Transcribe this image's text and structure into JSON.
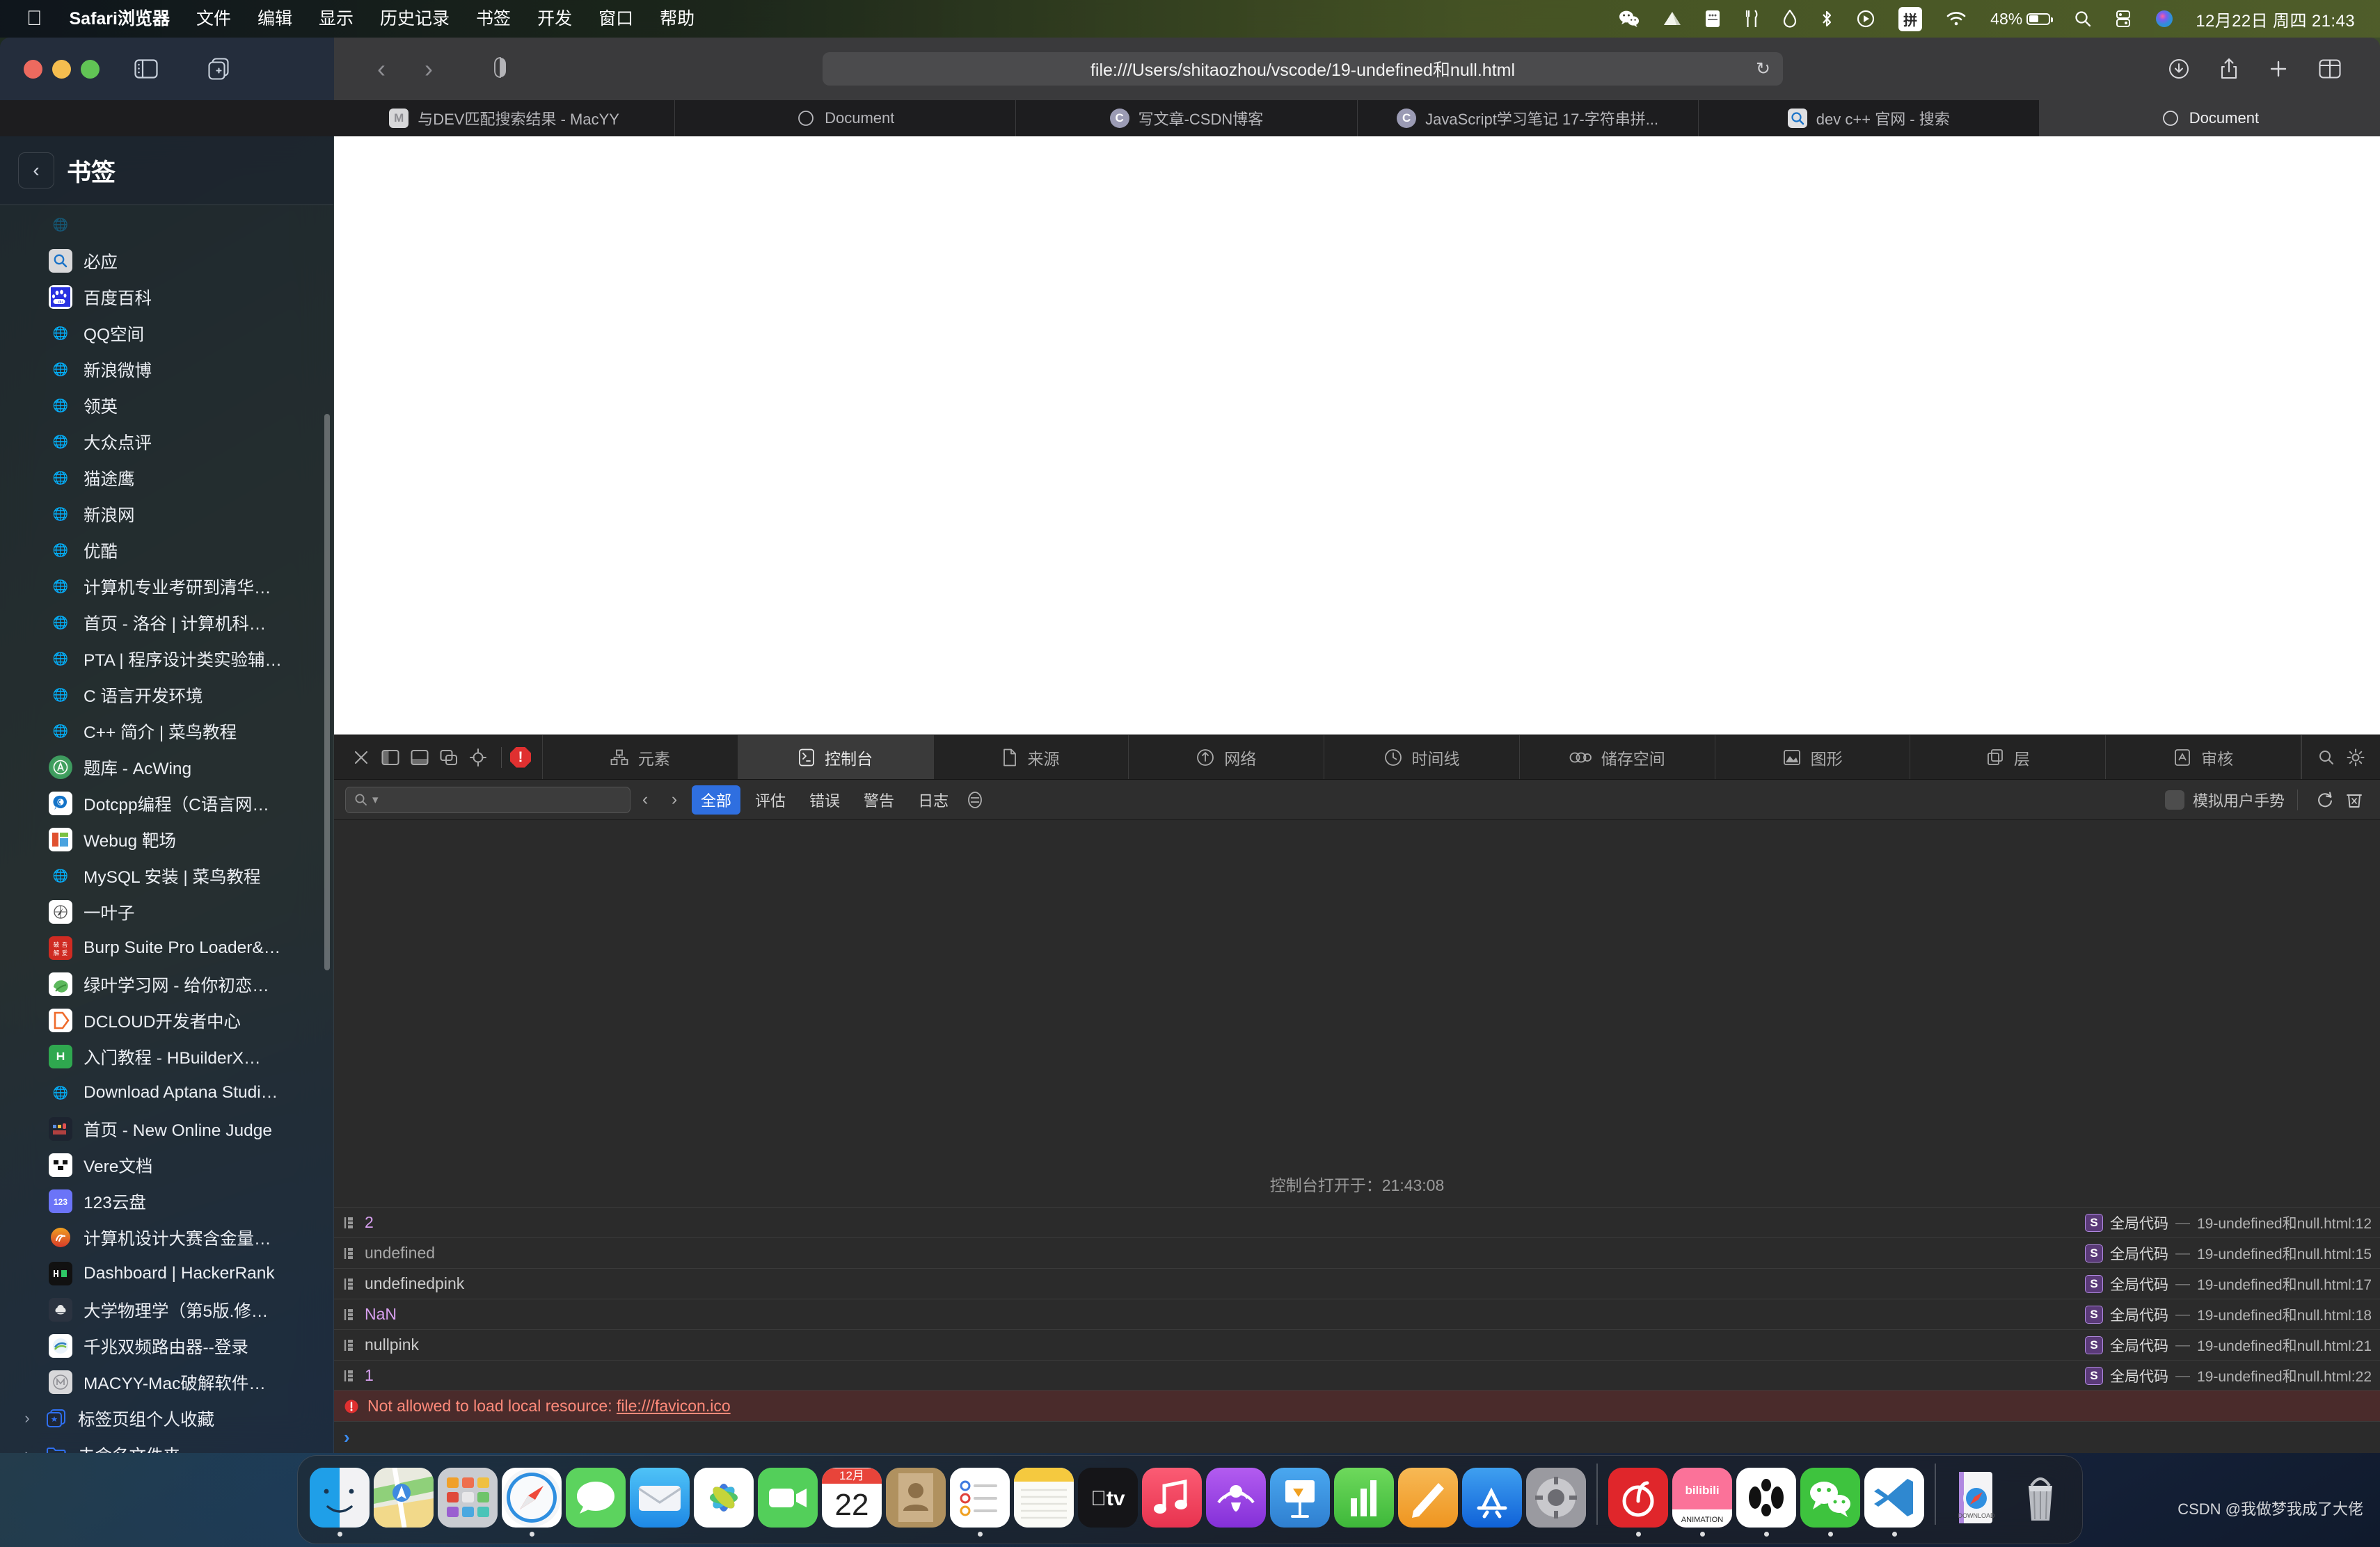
{
  "menubar": {
    "apple_icon": "apple-logo",
    "items": [
      "Safari浏览器",
      "文件",
      "编辑",
      "显示",
      "历史记录",
      "书签",
      "开发",
      "窗口",
      "帮助"
    ],
    "status_icons": [
      "wechat-icon",
      "cloud-icon",
      "memory-icon",
      "utensils-icon",
      "droplet-icon",
      "bluetooth-icon",
      "play-circle-icon",
      "input-source-icon",
      "wifi-icon"
    ],
    "battery_percent": "48%",
    "search_icon": "spotlight-search-icon",
    "control_center_icon": "control-center-icon",
    "siri_icon": "siri-icon",
    "clock": "12月22日 周四  21:43"
  },
  "toolbar": {
    "sidebar_icon": "sidebar-toggle-icon",
    "newtab_icon": "new-tab-overview-icon",
    "back_icon": "chevron-left-icon",
    "forward_icon": "chevron-right-icon",
    "shield_icon": "privacy-shield-icon",
    "url": "file:///Users/shitaozhou/vscode/19-undefined和null.html",
    "reload_icon": "reload-icon",
    "download_icon": "download-icon",
    "share_icon": "share-icon",
    "plus_icon": "new-tab-icon",
    "tabs_icon": "show-all-tabs-icon"
  },
  "tabs": [
    {
      "label": "与DEV匹配搜索结果 - MacYY",
      "favicon": "macyy-favicon",
      "favicon_letter": "M",
      "active": false
    },
    {
      "label": "Document",
      "favicon": "safari-compass-favicon",
      "favicon_letter": "",
      "active": false
    },
    {
      "label": "写文章-CSDN博客",
      "favicon": "csdn-favicon",
      "favicon_letter": "C",
      "active": false
    },
    {
      "label": "JavaScript学习笔记 17-字符串拼...",
      "favicon": "csdn-favicon",
      "favicon_letter": "C",
      "active": false
    },
    {
      "label": "dev c++ 官网 - 搜索",
      "favicon": "bing-favicon",
      "favicon_letter": "Q",
      "active": false
    },
    {
      "label": "Document",
      "favicon": "safari-compass-favicon",
      "favicon_letter": "",
      "active": true
    }
  ],
  "sidebar": {
    "back_icon": "chevron-left-icon",
    "title": "书签",
    "bookmarks": [
      {
        "label": "",
        "icon": "globe-icon",
        "icon_kind": "globe",
        "clipped": true
      },
      {
        "label": "必应",
        "icon": "bing-icon",
        "icon_kind": "bing"
      },
      {
        "label": "百度百科",
        "icon": "baidu-icon",
        "icon_kind": "baidu"
      },
      {
        "label": "QQ空间",
        "icon": "globe-icon",
        "icon_kind": "globe"
      },
      {
        "label": "新浪微博",
        "icon": "globe-icon",
        "icon_kind": "globe"
      },
      {
        "label": "领英",
        "icon": "globe-icon",
        "icon_kind": "globe"
      },
      {
        "label": "大众点评",
        "icon": "globe-icon",
        "icon_kind": "globe"
      },
      {
        "label": "猫途鹰",
        "icon": "globe-icon",
        "icon_kind": "globe"
      },
      {
        "label": "新浪网",
        "icon": "globe-icon",
        "icon_kind": "globe"
      },
      {
        "label": "优酷",
        "icon": "globe-icon",
        "icon_kind": "globe"
      },
      {
        "label": "计算机专业考研到清华…",
        "icon": "globe-icon",
        "icon_kind": "globe"
      },
      {
        "label": "首页 - 洛谷 | 计算机科…",
        "icon": "globe-icon",
        "icon_kind": "globe"
      },
      {
        "label": "PTA | 程序设计类实验辅…",
        "icon": "globe-icon",
        "icon_kind": "globe"
      },
      {
        "label": "C 语言开发环境",
        "icon": "globe-icon",
        "icon_kind": "globe"
      },
      {
        "label": "C++ 简介 | 菜鸟教程",
        "icon": "globe-icon",
        "icon_kind": "globe"
      },
      {
        "label": "题库 - AcWing",
        "icon": "acwing-icon",
        "icon_kind": "acwing"
      },
      {
        "label": "Dotcpp编程（C语言网…",
        "icon": "dotcpp-icon",
        "icon_kind": "dotcpp"
      },
      {
        "label": "Webug 靶场",
        "icon": "webug-icon",
        "icon_kind": "webug"
      },
      {
        "label": "MySQL 安装 | 菜鸟教程",
        "icon": "globe-icon",
        "icon_kind": "globe"
      },
      {
        "label": "一叶子",
        "icon": "yiyezi-icon",
        "icon_kind": "yiyezi"
      },
      {
        "label": "Burp Suite Pro Loader&…",
        "icon": "52pojie-icon",
        "icon_kind": "pojie"
      },
      {
        "label": "绿叶学习网 - 给你初恋…",
        "icon": "lvye-icon",
        "icon_kind": "lvye"
      },
      {
        "label": "DCLOUD开发者中心",
        "icon": "dcloud-icon",
        "icon_kind": "dcloud"
      },
      {
        "label": "入门教程 - HBuilderX…",
        "icon": "hbuilderx-icon",
        "icon_kind": "hbuilder"
      },
      {
        "label": "Download Aptana Studi…",
        "icon": "globe-icon",
        "icon_kind": "globe"
      },
      {
        "label": "首页 - New Online Judge",
        "icon": "noj-icon",
        "icon_kind": "noj"
      },
      {
        "label": "Vere文档",
        "icon": "vere-icon",
        "icon_kind": "vere"
      },
      {
        "label": "123云盘",
        "icon": "123pan-icon",
        "icon_kind": "pan123"
      },
      {
        "label": "计算机设计大赛含金量…",
        "icon": "zhihu-icon",
        "icon_kind": "zhihu"
      },
      {
        "label": "Dashboard | HackerRank",
        "icon": "hackerrank-icon",
        "icon_kind": "hackerrank"
      },
      {
        "label": "大学物理学（第5版.修…",
        "icon": "book-icon",
        "icon_kind": "book"
      },
      {
        "label": "千兆双频路由器--登录",
        "icon": "router-icon",
        "icon_kind": "router"
      },
      {
        "label": "MACYY-Mac破解软件…",
        "icon": "macyy-icon",
        "icon_kind": "macyy"
      }
    ],
    "folders": [
      {
        "label": "标签页组个人收藏",
        "icon": "tab-group-star-icon",
        "chevron": "chevron-right-icon"
      },
      {
        "label": "未命名文件夹",
        "icon": "folder-icon",
        "chevron": "chevron-right-icon"
      }
    ]
  },
  "inspector": {
    "left_buttons": [
      "close-inspector-icon",
      "dock-left-icon",
      "dock-bottom-icon",
      "dock-detach-icon",
      "inspect-element-icon"
    ],
    "error_badge": "!",
    "panels": [
      {
        "label": "元素",
        "icon": "elements-icon",
        "active": false
      },
      {
        "label": "控制台",
        "icon": "console-icon",
        "active": true
      },
      {
        "label": "来源",
        "icon": "sources-icon",
        "active": false
      },
      {
        "label": "网络",
        "icon": "network-icon",
        "active": false
      },
      {
        "label": "时间线",
        "icon": "timeline-icon",
        "active": false
      },
      {
        "label": "储存空间",
        "icon": "storage-icon",
        "active": false
      },
      {
        "label": "图形",
        "icon": "graphics-icon",
        "active": false
      },
      {
        "label": "层",
        "icon": "layers-icon",
        "active": false
      },
      {
        "label": "审核",
        "icon": "audit-icon",
        "active": false
      }
    ],
    "right_buttons": [
      "search-icon",
      "settings-gear-icon"
    ],
    "filter": {
      "search_icon": "search-icon",
      "search_placeholder": "",
      "search_value": "",
      "prev_icon": "chevron-left-icon",
      "next_icon": "chevron-right-icon",
      "chips": [
        {
          "label": "全部",
          "active": true
        },
        {
          "label": "评估",
          "active": false
        },
        {
          "label": "错误",
          "active": false
        },
        {
          "label": "警告",
          "active": false
        },
        {
          "label": "日志",
          "active": false
        }
      ],
      "group_icon": "grouping-icon",
      "emulate_label": "模拟用户手势",
      "emulate_checked": false,
      "preserve_icon": "preserve-log-icon",
      "clear_icon": "clear-console-icon"
    },
    "console_opened": "控制台打开于：21:43:08",
    "log_entries": [
      {
        "bullet": "log-output-icon",
        "message": "2",
        "kind": "number",
        "scope": "全局代码",
        "source": "19-undefined和null.html:12",
        "badge": "S"
      },
      {
        "bullet": "log-output-icon",
        "message": "undefined",
        "kind": "dim",
        "scope": "全局代码",
        "source": "19-undefined和null.html:15",
        "badge": "S"
      },
      {
        "bullet": "log-output-icon",
        "message": "undefinedpink",
        "kind": "text",
        "scope": "全局代码",
        "source": "19-undefined和null.html:17",
        "badge": "S"
      },
      {
        "bullet": "log-output-icon",
        "message": "NaN",
        "kind": "number",
        "scope": "全局代码",
        "source": "19-undefined和null.html:18",
        "badge": "S"
      },
      {
        "bullet": "log-output-icon",
        "message": "nullpink",
        "kind": "text",
        "scope": "全局代码",
        "source": "19-undefined和null.html:21",
        "badge": "S"
      },
      {
        "bullet": "log-output-icon",
        "message": "1",
        "kind": "number",
        "scope": "全局代码",
        "source": "19-undefined和null.html:22",
        "badge": "S"
      }
    ],
    "error_entry": {
      "bullet": "error-icon",
      "message_prefix": "Not allowed to load local resource: ",
      "message_link": "file:///favicon.ico"
    },
    "prompt": "›"
  },
  "dock": {
    "items": [
      {
        "name": "finder",
        "running": true
      },
      {
        "name": "maps",
        "running": false
      },
      {
        "name": "launchpad",
        "running": false
      },
      {
        "name": "safari",
        "running": true
      },
      {
        "name": "messages",
        "running": false
      },
      {
        "name": "mail",
        "running": false
      },
      {
        "name": "photos",
        "running": false
      },
      {
        "name": "facetime",
        "running": false
      },
      {
        "name": "calendar",
        "running": false,
        "label": "12月",
        "day": "22"
      },
      {
        "name": "contacts",
        "running": false
      },
      {
        "name": "reminders",
        "running": true
      },
      {
        "name": "notes",
        "running": false
      },
      {
        "name": "appletv",
        "running": false
      },
      {
        "name": "music",
        "running": false
      },
      {
        "name": "podcasts",
        "running": false
      },
      {
        "name": "keynote",
        "running": false
      },
      {
        "name": "numbers",
        "running": false
      },
      {
        "name": "pages",
        "running": false
      },
      {
        "name": "appstore",
        "running": false
      },
      {
        "name": "system-settings",
        "running": false
      },
      {
        "name": "netease-music",
        "running": true
      },
      {
        "name": "bilibili",
        "running": true
      },
      {
        "name": "threebody-animation",
        "running": true
      },
      {
        "name": "wechat",
        "running": true
      },
      {
        "name": "vscode",
        "running": true
      },
      {
        "name": "downloads-stack",
        "running": false
      },
      {
        "name": "trash",
        "running": false
      }
    ]
  },
  "watermark": "CSDN @我做梦我成了大佬"
}
